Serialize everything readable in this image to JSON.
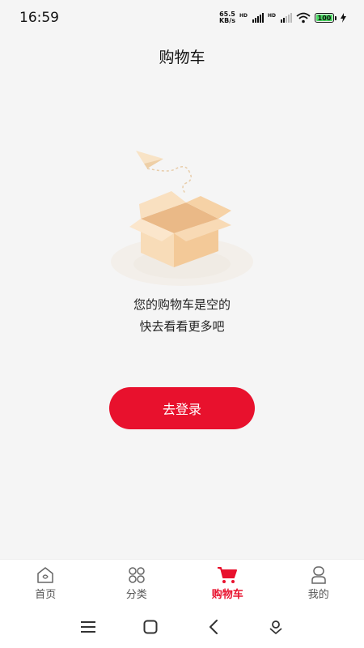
{
  "status_bar": {
    "time": "16:59",
    "net_speed_value": "65.5",
    "net_speed_unit": "KB/s",
    "hd_label": "HD",
    "battery": "100"
  },
  "page": {
    "title": "购物车"
  },
  "empty_state": {
    "line1": "您的购物车是空的",
    "line2": "快去看看更多吧",
    "illustration": "empty-box-with-paper-plane"
  },
  "login_button": {
    "label": "去登录"
  },
  "tab_bar": {
    "tabs": [
      {
        "label": "首页",
        "icon": "home-icon",
        "active": false
      },
      {
        "label": "分类",
        "icon": "category-icon",
        "active": false
      },
      {
        "label": "购物车",
        "icon": "cart-icon",
        "active": true
      },
      {
        "label": "我的",
        "icon": "profile-icon",
        "active": false
      }
    ]
  },
  "colors": {
    "accent": "#e8112d",
    "background": "#f5f5f5",
    "box": "#f6d7b0"
  },
  "nav_bar": {
    "buttons": [
      "menu-icon",
      "home-square-icon",
      "back-icon",
      "assistant-icon"
    ]
  }
}
